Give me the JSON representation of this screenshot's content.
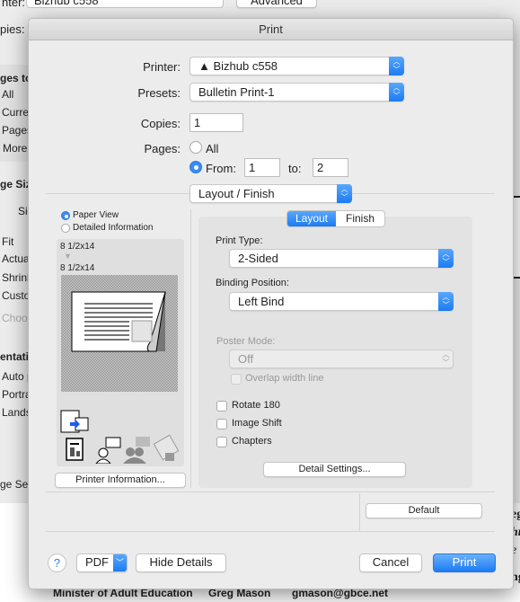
{
  "background": {
    "top_label_printer": "nter:",
    "top_printer_value": "Bizhub c558",
    "advanced_button": "Advanced",
    "copies_label": "pies:",
    "left_items": [
      "ges to",
      "All",
      "Curre",
      "Pages",
      "More",
      "ge Siz",
      "Si",
      "Fit",
      "Actua",
      "Shrink",
      "Custo",
      "Choos",
      "entatio",
      "Auto p",
      "Portra",
      "Lands",
      "ge Se"
    ],
    "right_fragments": [
      "eg",
      "hr",
      "e",
      "ng"
    ],
    "document_footer": [
      "Minister of Adult Education",
      "Greg Mason",
      "gmason@gbce.net"
    ]
  },
  "dialog": {
    "title": "Print",
    "printer_label": "Printer:",
    "printer_value": "Bizhub c558",
    "printer_warning_icon": "warning-triangle-icon",
    "presets_label": "Presets:",
    "presets_value": "Bulletin Print-1",
    "copies_label": "Copies:",
    "copies_value": "1",
    "pages_label": "Pages:",
    "pages_all": "All",
    "pages_from": "From:",
    "pages_from_value": "1",
    "pages_to": "to:",
    "pages_to_value": "2",
    "pages_selected": "From",
    "panel_select": "Layout / Finish",
    "preview": {
      "paper_view": "Paper View",
      "detailed_info": "Detailed Information",
      "selected": "Paper View",
      "paper_size_from": "8 1/2x14",
      "paper_size_to": "8 1/2x14",
      "printer_info_button": "Printer Information..."
    },
    "tabs": [
      "Layout",
      "Finish"
    ],
    "active_tab": "Layout",
    "print_type_label": "Print Type:",
    "print_type_value": "2-Sided",
    "binding_label": "Binding Position:",
    "binding_value": "Left Bind",
    "poster_label": "Poster Mode:",
    "poster_value": "Off",
    "overlap_label": "Overlap width line",
    "checkboxes": [
      {
        "label": "Rotate 180",
        "checked": false
      },
      {
        "label": "Image Shift",
        "checked": false
      },
      {
        "label": "Chapters",
        "checked": false
      }
    ],
    "detail_settings": "Detail Settings...",
    "default_button": "Default",
    "help": "?",
    "pdf": "PDF",
    "hide_details": "Hide Details",
    "cancel": "Cancel",
    "print": "Print",
    "accent": "#1b7cf3"
  }
}
